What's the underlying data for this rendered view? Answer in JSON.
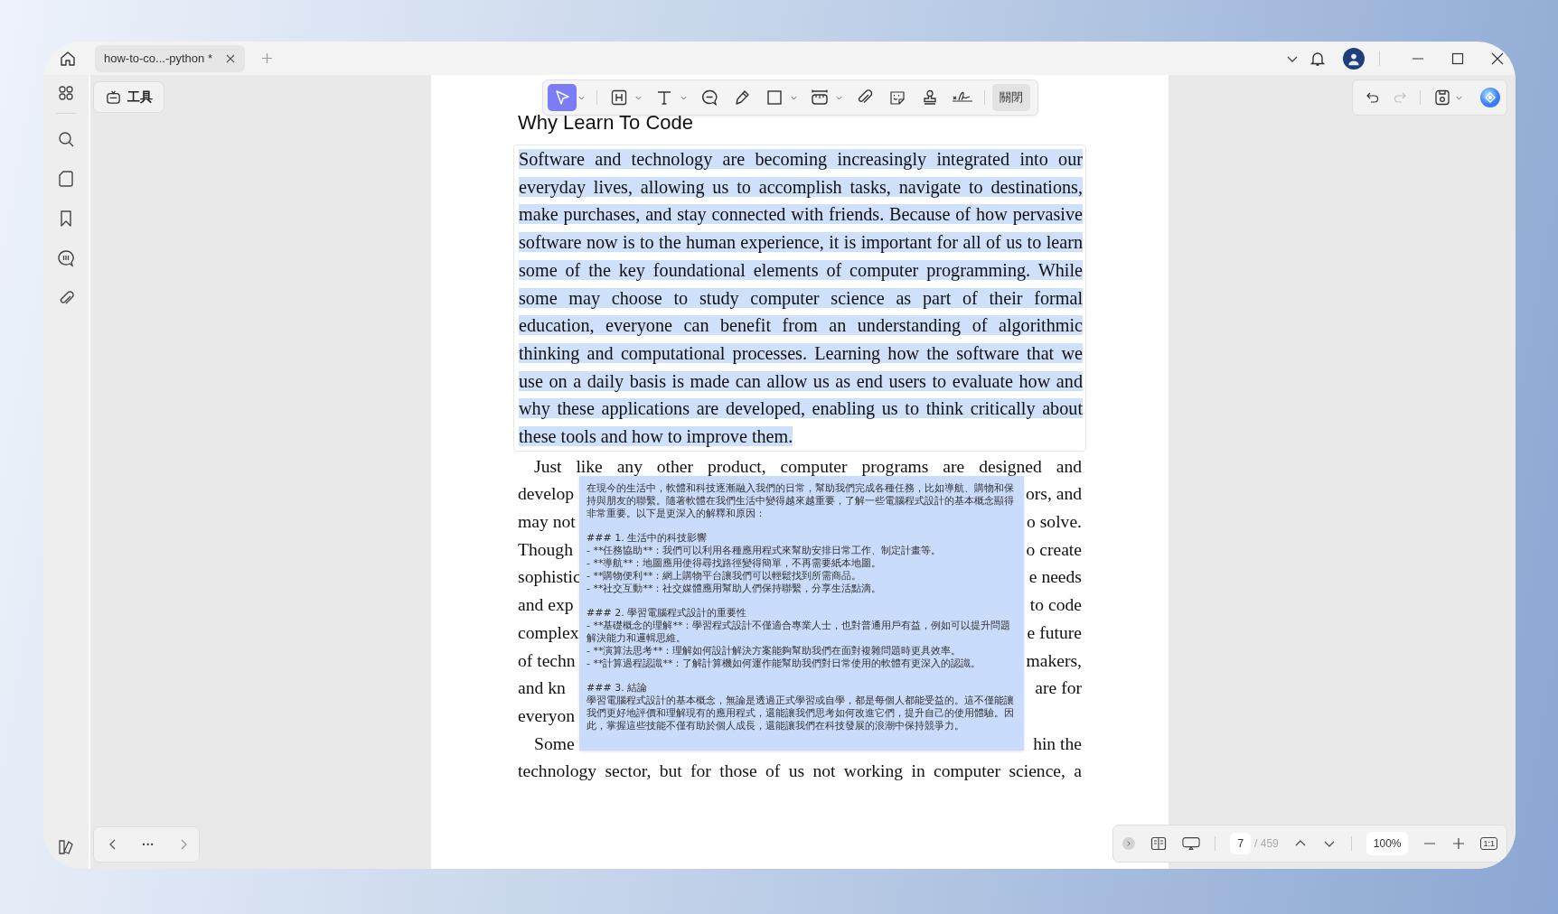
{
  "tabs": [
    {
      "label": "how-to-co...-python *",
      "selected": true
    }
  ],
  "left_panel": {
    "tools_button": "工具"
  },
  "toolbar": {
    "tools": [
      {
        "kind": "select",
        "selected": true,
        "dropdown": true
      },
      {
        "kind": "heading",
        "selected": false,
        "dropdown": true
      },
      {
        "kind": "text",
        "selected": false,
        "dropdown": true
      },
      {
        "kind": "comment",
        "selected": false,
        "dropdown": false
      },
      {
        "kind": "pen",
        "selected": false,
        "dropdown": false
      },
      {
        "kind": "shape",
        "selected": false,
        "dropdown": true
      },
      {
        "kind": "measure",
        "selected": false,
        "dropdown": true
      },
      {
        "kind": "attach",
        "selected": false,
        "dropdown": false
      },
      {
        "kind": "sticker",
        "selected": false,
        "dropdown": false
      },
      {
        "kind": "stamp",
        "selected": false,
        "dropdown": false
      },
      {
        "kind": "signature",
        "selected": false,
        "dropdown": false
      }
    ],
    "close_button": "關閉"
  },
  "history": {
    "undo": {
      "disabled": false
    },
    "redo": {
      "disabled": true
    }
  },
  "document": {
    "heading": "Why Learn To Code",
    "paragraph": {
      "text": "Software and technology are becoming increasingly integrated into our everyday lives, allowing us to accomplish tasks, navigate to destinations, make purchases, and stay connected with friends. Because of how pervasive software now is to the human experience, it is important for all of us to learn some of the key foundational elements of computer programming. While some may choose to study computer science as part of their formal education, everyone can benefit from an understanding of algorithmic thinking and computational processes. Learning how the software that we use on a daily basis is made can allow us as end users to evaluate how and why these applications are developed, enabling us to think critically about these tools and how to improve them.",
      "selected": true
    },
    "partial_lines": [
      {
        "kind": "indent_full",
        "left": "Just like any other product, computer programs are designed and"
      },
      {
        "kind": "split",
        "left": "develop",
        "right": "ors, and"
      },
      {
        "kind": "split",
        "left": "may not",
        "right": "o solve."
      },
      {
        "kind": "split",
        "left": "Though",
        "right": "o create"
      },
      {
        "kind": "split",
        "left": "sophistic",
        "right": "e needs"
      },
      {
        "kind": "split",
        "left": "and exp",
        "right": "to code"
      },
      {
        "kind": "split",
        "left": "complex",
        "right": "e future"
      },
      {
        "kind": "split",
        "left": "of techn",
        "right": "makers,"
      },
      {
        "kind": "split",
        "left": "and kn",
        "right": "are for"
      },
      {
        "kind": "split",
        "left": "everyon"
      },
      {
        "kind": "indent_split",
        "left": "Some",
        "right": "hin the"
      },
      {
        "kind": "full",
        "left": "technology sector, but for those of us not working in computer science, a"
      }
    ]
  },
  "popup": {
    "paragraphs": [
      [
        "在現今的生活中，軟體和科技逐漸融入我們的日常，幫助我們完成各種任務，比如導航、購物和保持與朋友的聯繫。隨著軟體在我們生活中變得越來越重要，了解一些電腦程式設計的基本概念顯得非常重要。以下是更深入的解釋和原因："
      ],
      [
        "### 1. 生活中的科技影響",
        "- **任務協助**：我們可以利用各種應用程式來幫助安排日常工作、制定計畫等。",
        "- **導航**：地圖應用使得尋找路徑變得簡單，不再需要紙本地圖。",
        "- **購物便利**：網上購物平台讓我們可以輕鬆找到所需商品。",
        "- **社交互動**：社交媒體應用幫助人們保持聯繫，分享生活點滴。"
      ],
      [
        "### 2. 學習電腦程式設計的重要性",
        "- **基礎概念的理解**：學習程式設計不僅適合專業人士，也對普通用戶有益，例如可以提升問題解決能力和邏輯思維。",
        "- **演算法思考**：理解如何設計解決方案能夠幫助我們在面對複雜問題時更具效率。",
        "- **計算過程認識**：了解計算機如何運作能幫助我們對日常使用的軟體有更深入的認識。"
      ],
      [
        "### 3. 結論",
        "學習電腦程式設計的基本概念，無論是透過正式學習或自學，都是每個人都能受益的。這不僅能讓我們更好地評價和理解現有的應用程式，還能讓我們思考如何改進它們，提升自己的使用體驗。因此，掌握這些技能不僅有助於個人成長，還能讓我們在科技發展的浪潮中保持競爭力。"
      ]
    ]
  },
  "nav": {
    "more": "···"
  },
  "status": {
    "page": "7",
    "total": "/ 459",
    "zoom": "100%",
    "fit": "1:1"
  }
}
